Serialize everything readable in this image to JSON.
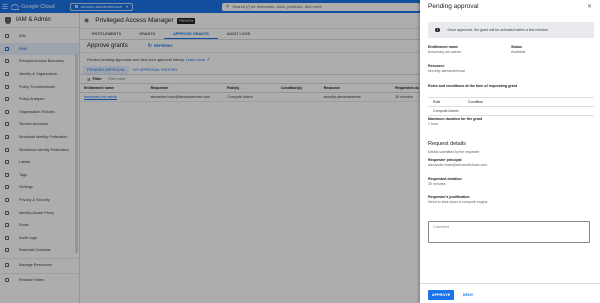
{
  "topbar": {
    "logo_text": "Google Cloud",
    "project": "security-alexanderhose",
    "search_placeholder": "Search (/) for resources, docs, products, and more"
  },
  "nav": {
    "header": "IAM & Admin",
    "items": [
      {
        "label": "IAM",
        "active": false
      },
      {
        "label": "PAM",
        "active": true
      },
      {
        "label": "Principal Access Boundary",
        "active": false
      },
      {
        "label": "Identity & Organization",
        "active": false
      },
      {
        "label": "Policy Troubleshooter",
        "active": false
      },
      {
        "label": "Policy Analyzer",
        "active": false
      },
      {
        "label": "Organization Policies",
        "active": false
      },
      {
        "label": "Service Accounts",
        "active": false
      },
      {
        "label": "Workload Identity Federation",
        "active": false
      },
      {
        "label": "Workforce Identity Federation",
        "active": false
      },
      {
        "label": "Labels",
        "active": false
      },
      {
        "label": "Tags",
        "active": false
      },
      {
        "label": "Settings",
        "active": false
      },
      {
        "label": "Privacy & Security",
        "active": false
      },
      {
        "label": "Identity-Aware Proxy",
        "active": false
      },
      {
        "label": "Roles",
        "active": false
      },
      {
        "label": "Audit Logs",
        "active": false
      },
      {
        "label": "Essential Contacts",
        "active": false
      }
    ],
    "manage_resources": "Manage Resources",
    "release_notes": "Release Notes"
  },
  "main": {
    "title": "Privileged Access Manager",
    "badge": "PREVIEW",
    "tabs": [
      "ENTITLEMENTS",
      "GRANTS",
      "APPROVE GRANTS",
      "AUDIT LOGS"
    ],
    "section_title": "Approve grants",
    "refresh_label": "REFRESH",
    "description": "Review pending approvals and view your approval history.",
    "learn_more": "Learn more",
    "subtabs": [
      "PENDING APPROVAL",
      "MY APPROVAL HISTORY"
    ],
    "filter_label": "Filter",
    "filter_placeholder": "Filter table",
    "columns": [
      "Entitlement name",
      "Requester",
      "Role(s)",
      "Condition(s)",
      "Resource",
      "Requested du"
    ],
    "rows": [
      [
        "temporary-vm-admin",
        "alexander.hose@alexanderhose.com",
        "Compute Admin",
        "",
        "security-alexanderhose",
        "30 minutes"
      ]
    ]
  },
  "panel": {
    "title": "Pending approval",
    "info": "Once approved, the grant will be activated within a few minutes",
    "entitlement_label": "Entitlement name",
    "entitlement_value": "temporary-vm-admin",
    "status_label": "Status",
    "status_value": "Available",
    "resource_label": "Resource",
    "resource_value": "security-alexanderhose",
    "roles_label": "Roles and conditions at the time of requesting grant",
    "roles_headers": [
      "Role",
      "Condition"
    ],
    "roles_row": [
      "Compute Admin",
      ""
    ],
    "max_duration_label": "Maximum duration for the grant",
    "max_duration_value": "1 hour",
    "request_details_title": "Request details",
    "request_details_sub": "Details submitted by the requester",
    "principal_label": "Requester principal",
    "principal_value": "alexander.hose@alexanderhose.com",
    "requested_duration_label": "Requested duration",
    "requested_duration_value": "30 minutes",
    "justification_label": "Requester's justification",
    "justification_value": "Need to shut down a compute engine",
    "comment_placeholder": "Comment",
    "approve_label": "APPROVE",
    "deny_label": "DENY"
  },
  "colors": {
    "accent": "#1a73e8",
    "overlay": "rgba(0,0,0,0.32)"
  }
}
